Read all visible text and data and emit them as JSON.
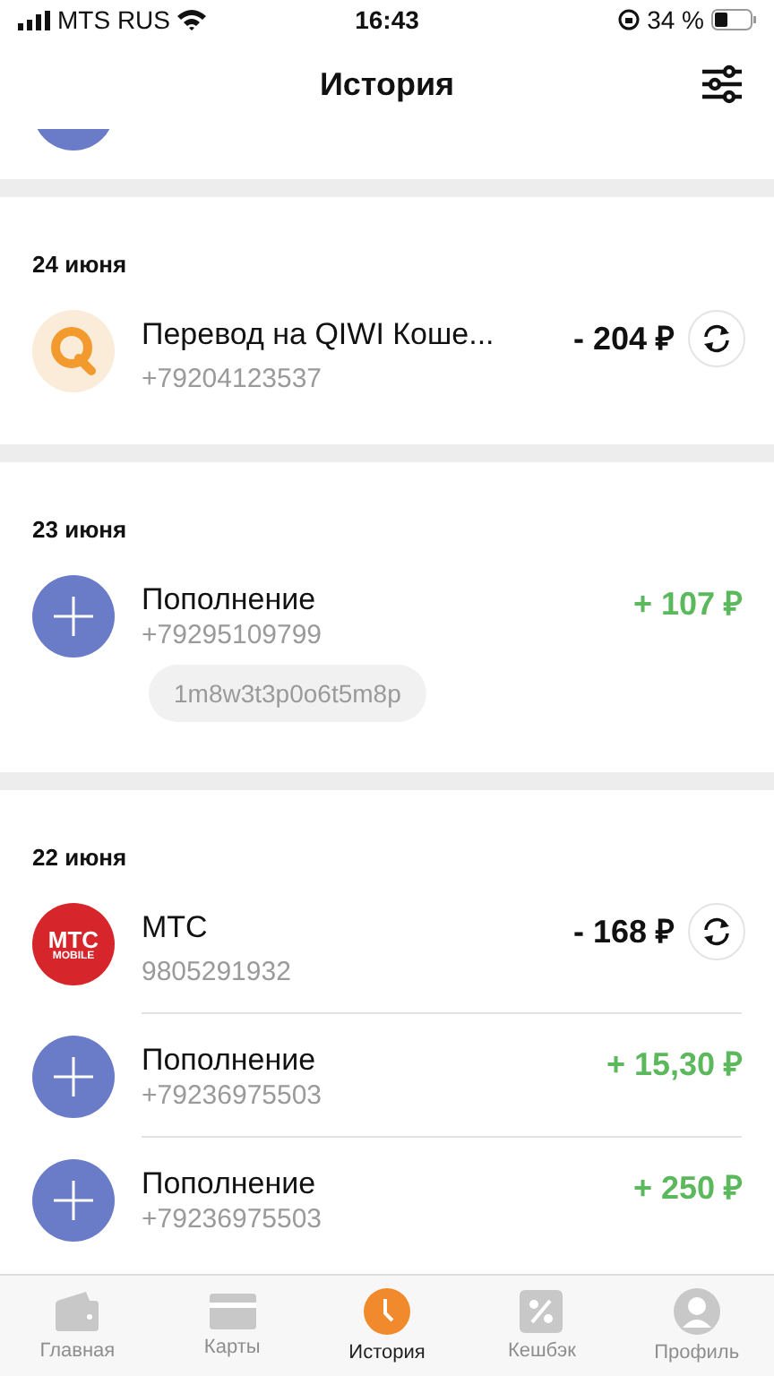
{
  "status_bar": {
    "carrier": "MTS RUS",
    "time": "16:43",
    "battery": "34 %"
  },
  "header": {
    "title": "История"
  },
  "sections": [
    {
      "date": "24 июня",
      "items": [
        {
          "kind": "qiwi",
          "title": "Перевод на QIWI Коше...",
          "subtitle": "+79204123537",
          "amount": "- 204 ₽",
          "credit": false,
          "repeat": true
        }
      ]
    },
    {
      "date": "23 июня",
      "items": [
        {
          "kind": "topup",
          "title": "Пополнение",
          "subtitle": "+79295109799",
          "amount": "+ 107 ₽",
          "credit": true,
          "repeat": false,
          "comment": "1m8w3t3p0o6t5m8p"
        }
      ]
    },
    {
      "date": "22 июня",
      "items": [
        {
          "kind": "mts",
          "title": "МТС",
          "subtitle": "9805291932",
          "amount": "- 168 ₽",
          "credit": false,
          "repeat": true,
          "logo_text": "МТС",
          "logo_subtext": "MOBILE"
        },
        {
          "kind": "topup",
          "title": "Пополнение",
          "subtitle": "+79236975503",
          "amount": "+ 15,30 ₽",
          "credit": true,
          "repeat": false
        },
        {
          "kind": "topup",
          "title": "Пополнение",
          "subtitle": "+79236975503",
          "amount": "+ 250 ₽",
          "credit": true,
          "repeat": false
        }
      ]
    }
  ],
  "tabs": [
    {
      "kind": "wallet",
      "label": "Главная",
      "selected": false
    },
    {
      "kind": "card",
      "label": "Карты",
      "selected": false
    },
    {
      "kind": "clock",
      "label": "История",
      "selected": true
    },
    {
      "kind": "percent",
      "label": "Кешбэк",
      "selected": false
    },
    {
      "kind": "profile",
      "label": "Профиль",
      "selected": false
    }
  ]
}
